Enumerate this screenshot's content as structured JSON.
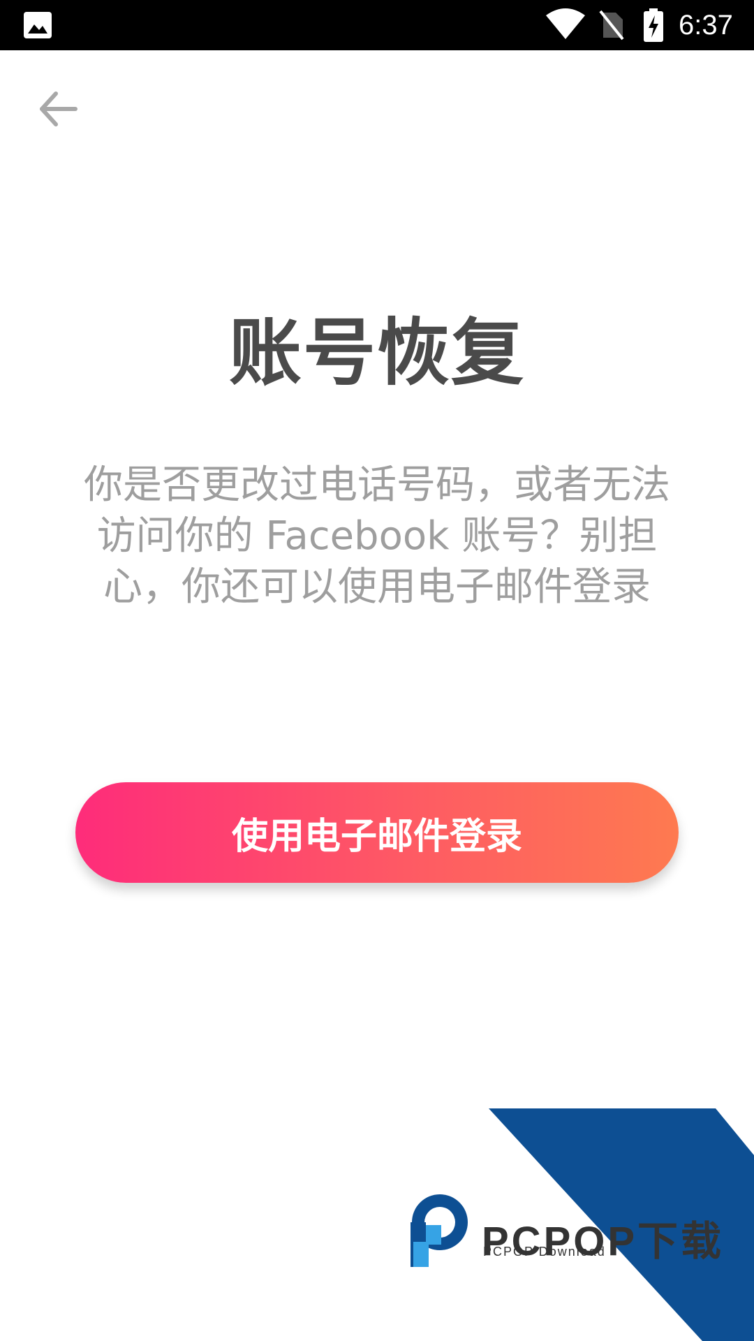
{
  "status_bar": {
    "time": "6:37",
    "icons": [
      "gallery-icon",
      "wifi-icon",
      "no-sim-icon",
      "battery-charging-icon"
    ]
  },
  "header": {
    "back_icon": "arrow-left-icon"
  },
  "main": {
    "title": "账号恢复",
    "description": "你是否更改过电话号码，或者无法访问你的 Facebook 账号？别担心，你还可以使用电子邮件登录",
    "button_label": "使用电子邮件登录"
  },
  "watermark": {
    "brand": "PCPOP下载",
    "sub": "PCPOP Download"
  },
  "colors": {
    "button_gradient_start": "#fe2c7a",
    "button_gradient_end": "#fe7a50",
    "title": "#4a4a4a",
    "description": "#9e9e9e",
    "watermark_blue": "#0d4f93",
    "watermark_light_blue": "#36a3e5"
  }
}
